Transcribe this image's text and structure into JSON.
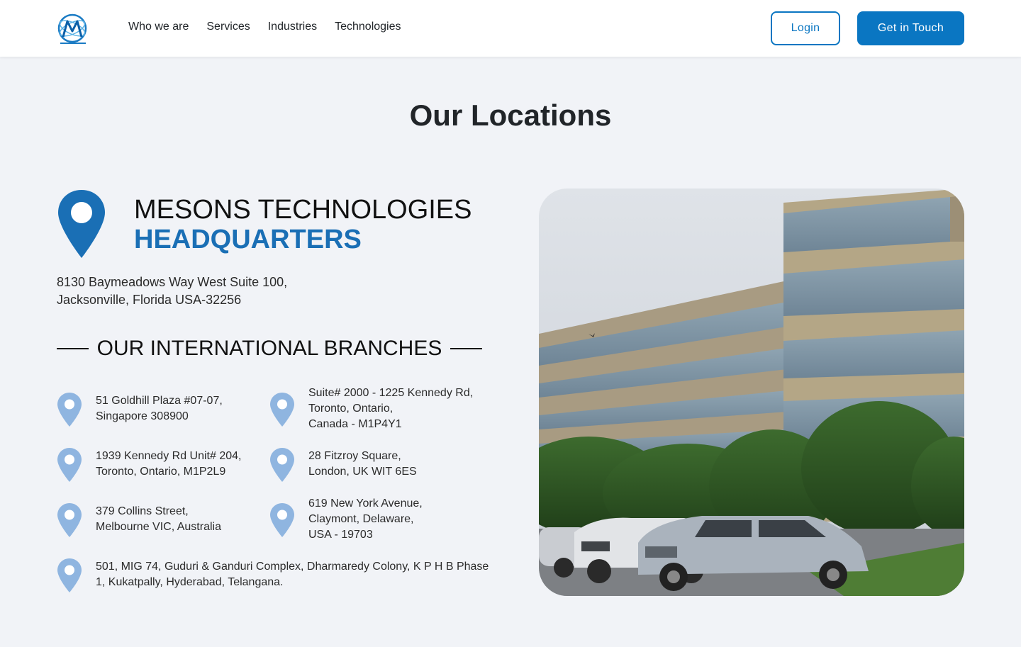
{
  "header": {
    "logo_icon": "mesons-logo-icon",
    "nav": [
      "Who we are",
      "Services",
      "Industries",
      "Technologies"
    ],
    "login_label": "Login",
    "cta_label": "Get in Touch",
    "brand_color": "#0a76c2"
  },
  "main": {
    "title": "Our Locations",
    "hq": {
      "title": "MESONS TECHNOLOGIES",
      "subtitle": "HEADQUARTERS",
      "address_line1": "8130 Baymeadows Way West Suite 100,",
      "address_line2": "Jacksonville, Florida USA-32256",
      "pin_color": "#1a6fb5"
    },
    "branches_heading": "OUR INTERNATIONAL BRANCHES",
    "branch_pin_color": "#8fb5e0",
    "branches": [
      {
        "lines": [
          "51 Goldhill Plaza #07-07,",
          "Singapore 308900"
        ]
      },
      {
        "lines": [
          "Suite# 2000 - 1225 Kennedy Rd,",
          "Toronto, Ontario,",
          "Canada - M1P4Y1"
        ]
      },
      {
        "lines": [
          "1939 Kennedy Rd Unit# 204,",
          "Toronto, Ontario, M1P2L9"
        ]
      },
      {
        "lines": [
          "28 Fitzroy Square,",
          "London, UK WIT 6ES"
        ]
      },
      {
        "lines": [
          "379 Collins Street,",
          "Melbourne VIC, Australia"
        ]
      },
      {
        "lines": [
          "619 New York Avenue,",
          "Claymont, Delaware,",
          "USA - 19703"
        ]
      },
      {
        "lines": [
          "501, MIG 74, Guduri & Ganduri Complex, Dharmaredy Colony, K P H B Phase",
          "1, Kukatpally, Hyderabad, Telangana."
        ]
      }
    ],
    "photo_icon": "headquarters-building-photo"
  }
}
